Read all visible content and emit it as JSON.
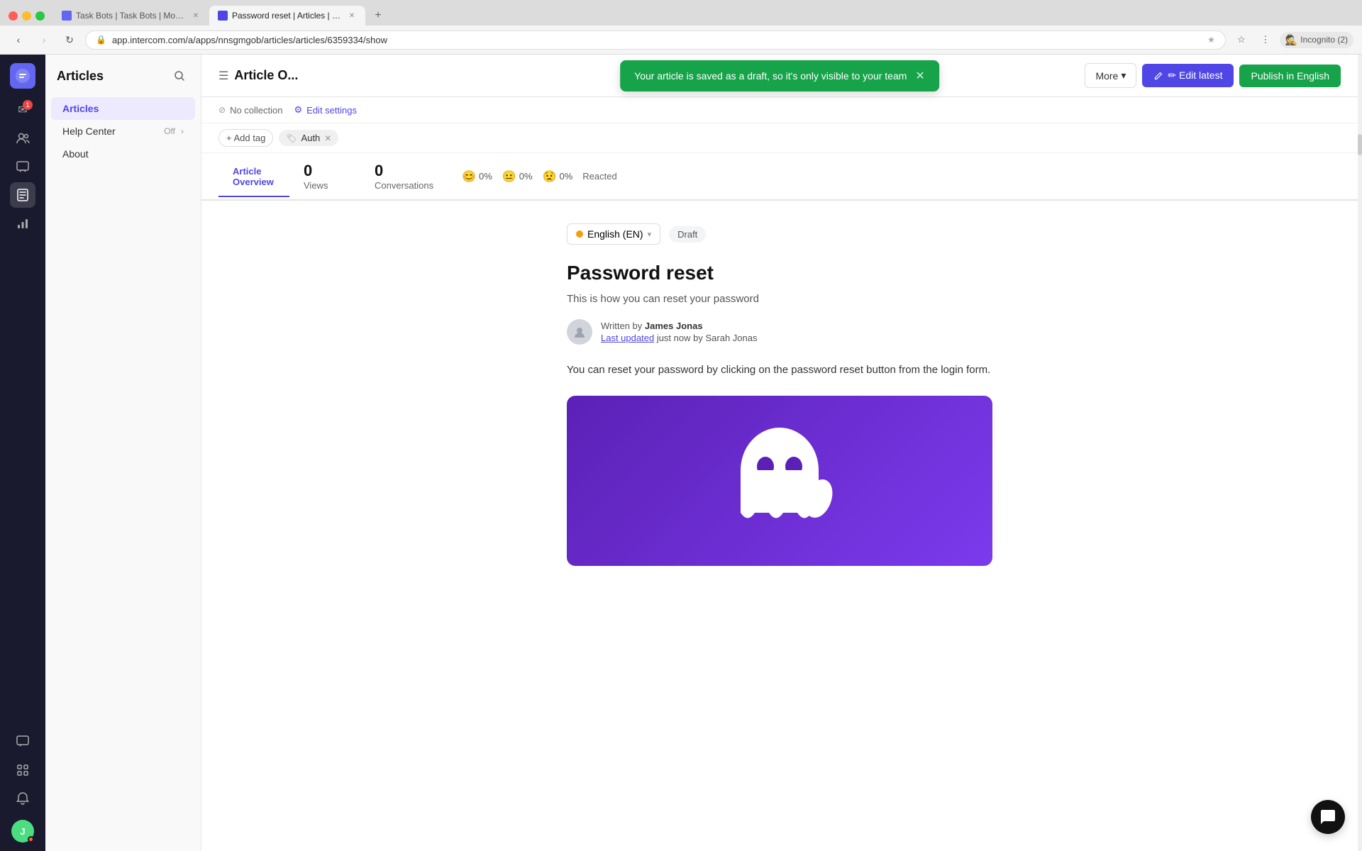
{
  "browser": {
    "tabs": [
      {
        "id": "tab1",
        "favicon_color": "#6366f1",
        "title": "Task Bots | Task Bots | Moodjo...",
        "active": false
      },
      {
        "id": "tab2",
        "favicon_color": "#4f46e5",
        "title": "Password reset | Articles | Mo...",
        "active": true
      }
    ],
    "new_tab_icon": "+",
    "address": "app.intercom.com/a/apps/nnsgmgob/articles/articles/6359334/show",
    "nav": {
      "back_disabled": false,
      "forward_disabled": true,
      "reload_icon": "↻"
    },
    "incognito_label": "Incognito (2)"
  },
  "left_nav": {
    "logo_letter": "◉",
    "items": [
      {
        "id": "inbox",
        "icon": "✉",
        "badge": "1",
        "has_badge": true
      },
      {
        "id": "contacts",
        "icon": "👥",
        "has_badge": false
      },
      {
        "id": "conversations",
        "icon": "💬",
        "has_badge": false
      },
      {
        "id": "articles",
        "icon": "📄",
        "has_badge": false,
        "active": true
      },
      {
        "id": "reports",
        "icon": "📊",
        "has_badge": false
      },
      {
        "id": "chat",
        "icon": "🗨",
        "has_badge": false
      },
      {
        "id": "apps",
        "icon": "⊞",
        "has_badge": false
      },
      {
        "id": "notifications",
        "icon": "🔔",
        "has_badge": false
      }
    ],
    "avatar_initials": "J",
    "avatar_dot_color": "#f97316"
  },
  "sidebar": {
    "title": "Articles",
    "items": [
      {
        "id": "articles",
        "label": "Articles",
        "active": true
      },
      {
        "id": "help-center",
        "label": "Help Center",
        "toggle": "Off",
        "has_toggle": true,
        "has_arrow": true
      },
      {
        "id": "about",
        "label": "About",
        "active": false
      }
    ]
  },
  "top_bar": {
    "menu_icon": "☰",
    "article_title": "Article O...",
    "more_button": "More",
    "more_chevron": "▾",
    "edit_button": "✏ Edit latest",
    "publish_button": "Publish in English"
  },
  "toast": {
    "message": "Your article is saved as a draft, so it's only visible to your team",
    "close_icon": "✕"
  },
  "meta_row": {
    "no_collection_icon": "⊘",
    "no_collection_label": "No collection",
    "edit_settings_icon": "⚙",
    "edit_settings_label": "Edit settings"
  },
  "tags_row": {
    "add_tag_label": "+ Add tag",
    "tags": [
      {
        "id": "auth",
        "label": "Auth",
        "icon": "🏷"
      }
    ]
  },
  "stats": {
    "tabs": [
      {
        "id": "overview",
        "top_label": "Article",
        "sub_label": "Overview",
        "active": true
      },
      {
        "id": "views",
        "number": "0",
        "name": "Views",
        "active": false
      },
      {
        "id": "conversations",
        "number": "0",
        "name": "Conversations",
        "active": false
      }
    ],
    "reactions": [
      {
        "id": "happy",
        "emoji": "😊",
        "percent": "0%"
      },
      {
        "id": "neutral",
        "emoji": "😐",
        "percent": "0%"
      },
      {
        "id": "sad",
        "emoji": "😟",
        "percent": "0%"
      },
      {
        "id": "label",
        "text": "Reacted"
      }
    ]
  },
  "article": {
    "lang_label": "English (EN)",
    "lang_chevron": "▾",
    "status_badge": "Draft",
    "title": "Password reset",
    "description": "This is how you can reset your password",
    "author_prefix": "Written by",
    "author_name": "James Jonas",
    "updated_prefix": "Last updated",
    "updated_time": "just now",
    "updated_by_prefix": "by",
    "updated_by": "Sarah Jonas",
    "body_text": "You can reset your password by clicking on the password reset button from the login form.",
    "image_alt": "Intercom ghost mascot illustration"
  },
  "chat_bubble_icon": "💬",
  "colors": {
    "accent": "#4f46e5",
    "green": "#16a34a",
    "left_nav_bg": "#1a1a2e"
  }
}
